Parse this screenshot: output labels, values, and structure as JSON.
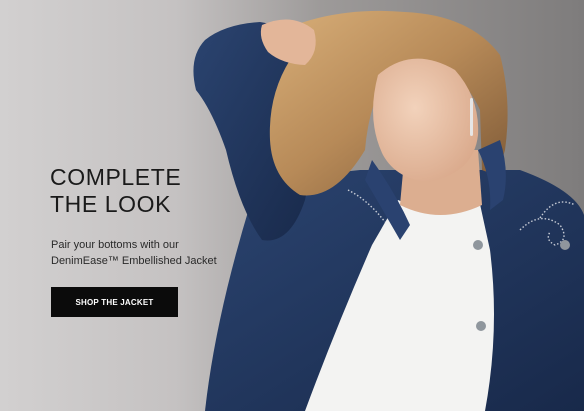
{
  "hero": {
    "headline": {
      "line1": "COMPLETE",
      "line2": "THE LOOK"
    },
    "subtext": {
      "line1": "Pair your bottoms with our",
      "line2": "DenimEase™ Embellished Jacket"
    },
    "cta_label": "SHOP THE JACKET",
    "colors": {
      "background": "#8d8b8a",
      "denim": "#1f3457",
      "shirt": "#f3f3f2",
      "hair": "#b78a58",
      "button": "#0b0b0b",
      "button_text": "#ffffff",
      "headline_text": "#1a1a1a"
    }
  }
}
